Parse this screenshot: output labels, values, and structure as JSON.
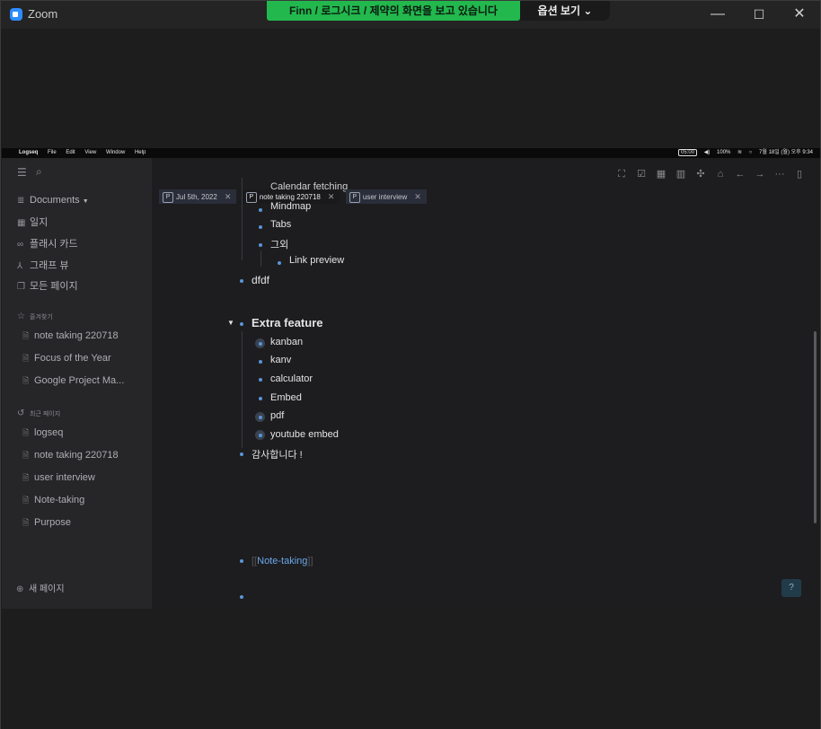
{
  "zoom": {
    "title": "Zoom",
    "share_banner": {
      "presenter": "Finn",
      "text": " / 로그시크 / 제약의 화면을 보고 있습니다"
    },
    "view_options": "옵션 보기 ⌄",
    "controls": {
      "minimize": "—",
      "maximize": "☐",
      "close": "✕"
    }
  },
  "macbar": {
    "apple": "",
    "app": "Logseq",
    "menus": [
      "File",
      "Edit",
      "View",
      "Window",
      "Help"
    ],
    "right": {
      "timer": "05:00",
      "battery": "100%",
      "datetime": "7월 18일 (월) 오후 9:34"
    }
  },
  "sidebar": {
    "graph_name": "Documents",
    "nav": [
      {
        "label": "일지",
        "icon": "calendar-icon"
      },
      {
        "label": "플래시 카드",
        "icon": "infinity-icon"
      },
      {
        "label": "그래프 뷰",
        "icon": "graph-icon"
      },
      {
        "label": "모든 페이지",
        "icon": "pages-icon"
      }
    ],
    "favorites_title": "즐겨찾기",
    "favorites": [
      "note taking 220718",
      "Focus of the Year",
      "Google Project Ma..."
    ],
    "recent_title": "최근 페이지",
    "recent": [
      "logseq",
      "note taking 220718",
      "user interview",
      "Note-taking",
      "Purpose"
    ],
    "new_page": "새 페이지"
  },
  "tabs": [
    {
      "label": "Jul 5th, 2022",
      "active": false
    },
    {
      "label": "note taking 220718",
      "active": true
    },
    {
      "label": "user interview",
      "active": false
    }
  ],
  "tab_prefix": "P",
  "tab_close": "✕",
  "content": {
    "partial_top": "Calendar fetching",
    "partial_mindmap": "Mindmap",
    "tabs_item": "Tabs",
    "etc": "그외",
    "link_preview": "Link preview",
    "dfdf": "dfdf",
    "extra_feature": "Extra feature",
    "extra_children": [
      "kanban",
      "kanv",
      "calculator",
      "Embed",
      "pdf",
      "youtube  embed"
    ],
    "thanks": "감사합니다 !",
    "ref_note_taking": "Note-taking"
  },
  "help": "?"
}
